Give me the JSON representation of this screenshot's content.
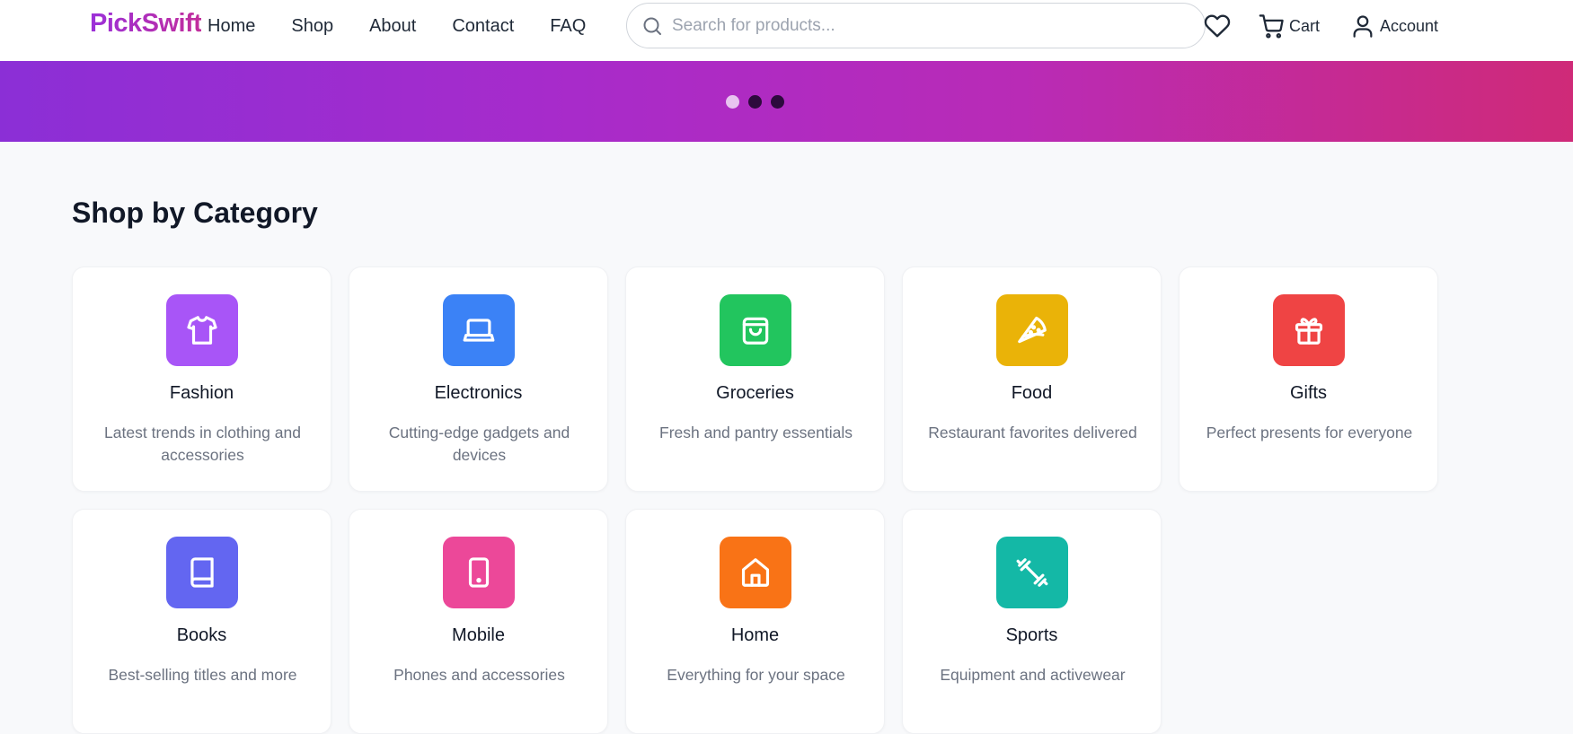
{
  "brand": {
    "name": "PickSwift"
  },
  "nav": {
    "items": [
      {
        "label": "Home"
      },
      {
        "label": "Shop"
      },
      {
        "label": "About"
      },
      {
        "label": "Contact"
      },
      {
        "label": "FAQ"
      }
    ]
  },
  "search": {
    "placeholder": "Search for products...",
    "value": ""
  },
  "actions": {
    "wishlist_icon": "heart-icon",
    "cart_label": "Cart",
    "cart_icon": "cart-icon",
    "account_label": "Account",
    "account_icon": "user-icon"
  },
  "banner": {
    "gradient": [
      "#8b2fd6",
      "#cf2a78"
    ],
    "slides": 3,
    "active_slide": 1
  },
  "categories": {
    "title": "Shop by Category",
    "items": [
      {
        "name": "Fashion",
        "description": "Latest trends in clothing and accessories",
        "icon": "shirt-icon",
        "color": "#a855f7"
      },
      {
        "name": "Electronics",
        "description": "Cutting-edge gadgets and devices",
        "icon": "laptop-icon",
        "color": "#3b82f6"
      },
      {
        "name": "Groceries",
        "description": "Fresh and pantry essentials",
        "icon": "shopping-bag-icon",
        "color": "#22c55e"
      },
      {
        "name": "Food",
        "description": "Restaurant favorites delivered",
        "icon": "pizza-icon",
        "color": "#eab308"
      },
      {
        "name": "Gifts",
        "description": "Perfect presents for everyone",
        "icon": "gift-icon",
        "color": "#ef4444"
      },
      {
        "name": "Books",
        "description": "Best-selling titles and more",
        "icon": "book-icon",
        "color": "#6366f1"
      },
      {
        "name": "Mobile",
        "description": "Phones and accessories",
        "icon": "smartphone-icon",
        "color": "#ec4899"
      },
      {
        "name": "Home",
        "description": "Everything for your space",
        "icon": "house-icon",
        "color": "#f97316"
      },
      {
        "name": "Sports",
        "description": "Equipment and activewear",
        "icon": "dumbbell-icon",
        "color": "#14b8a6"
      }
    ]
  }
}
